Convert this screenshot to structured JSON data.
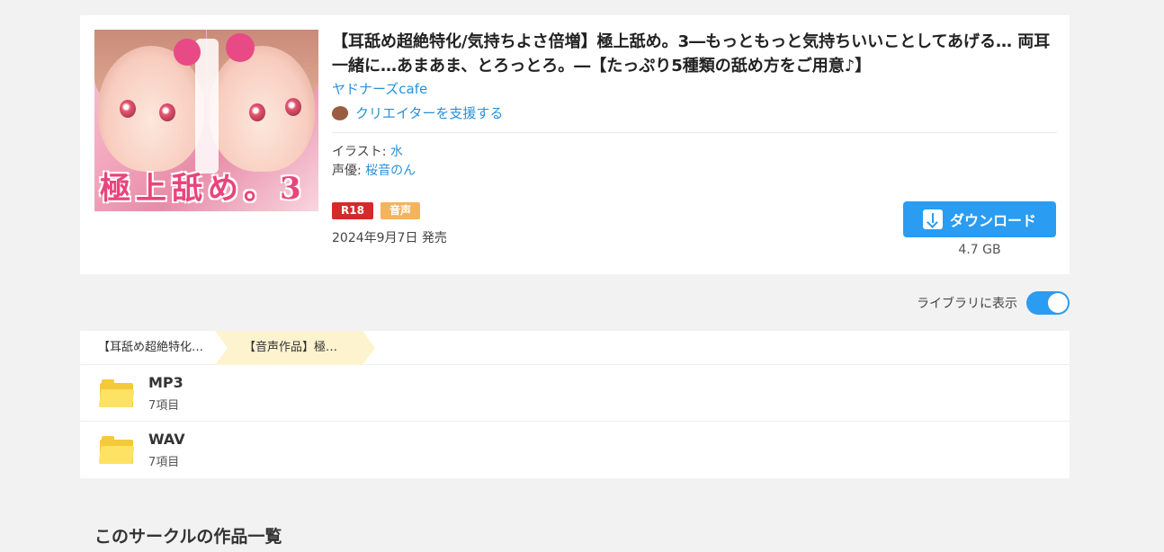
{
  "work": {
    "title": "【耳舐め超絶特化/気持ちよさ倍増】極上舐め。3―もっともっと気持ちいいことしてあげる… 両耳一緒に…あまあま、とろっとろ。―【たっぷり5種類の舐め方をご用意♪】",
    "circle": "ヤドナーズcafe",
    "support_label": "クリエイターを支援する",
    "illust_label": "イラスト: ",
    "illust_value": "水",
    "voice_label": "声優: ",
    "voice_value": "桜音のん",
    "tags": [
      "R18",
      "音声"
    ],
    "release": "2024年9月7日 発売",
    "download_label": "ダウンロード",
    "size": "4.7 GB",
    "cover_text": "極上舐め。3"
  },
  "library": {
    "label": "ライブラリに表示",
    "enabled": true
  },
  "browser": {
    "breadcrumbs": [
      "【耳舐め超絶特化…",
      "【音声作品】極…"
    ],
    "folders": [
      {
        "name": "MP3",
        "count": "7項目"
      },
      {
        "name": "WAV",
        "count": "7項目"
      }
    ]
  },
  "section": {
    "title": "このサークルの作品一覧"
  },
  "colors": {
    "accent": "#2a9cf2",
    "r18": "#d52a2a",
    "voice": "#f5b35c",
    "folder": "#fde264"
  }
}
